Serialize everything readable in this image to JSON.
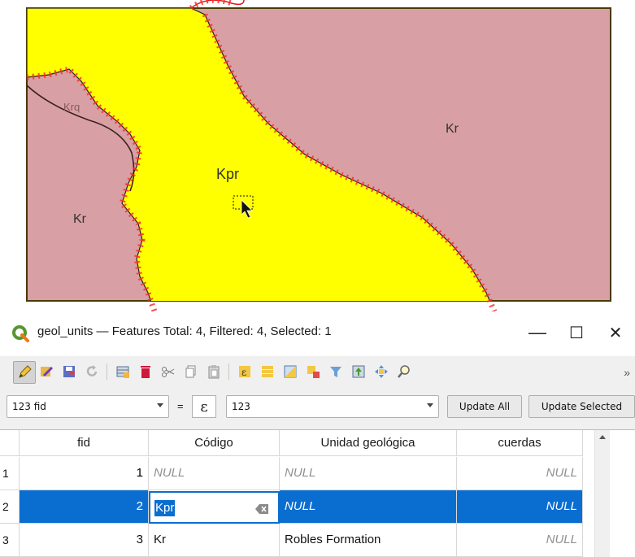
{
  "map": {
    "labels": {
      "krq": "Krq",
      "kr_left": "Kr",
      "kpr": "Kpr",
      "kr_right": "Kr"
    },
    "colors": {
      "yellow_unit": "#ffff00",
      "pink_unit": "#d8a0a4",
      "vertex_markers": "#ff2a2a",
      "boundary": "#2b2b2b"
    }
  },
  "window": {
    "title": "geol_units — Features Total: 4, Filtered: 4, Selected: 1",
    "minimize_symbol": "—",
    "maximize_symbol": "☐",
    "close_symbol": "✕"
  },
  "toolbar": {
    "icons": [
      "toggle-editing-icon",
      "multi-edit-icon",
      "save-edits-icon",
      "reload-icon",
      "add-feature-icon",
      "delete-feature-icon",
      "cut-icon",
      "copy-icon",
      "paste-icon",
      "expression-select-icon",
      "select-all-icon",
      "invert-selection-icon",
      "deselect-icon",
      "filter-icon",
      "move-selection-top-icon",
      "pan-to-selection-icon",
      "zoom-to-selection-icon"
    ],
    "more_label": "»"
  },
  "calc": {
    "field_value": "123 fid",
    "equals": "=",
    "expression_symbol": "ε",
    "value_input": "123",
    "update_all_label": "Update All",
    "update_selected_label": "Update Selected"
  },
  "table": {
    "columns": [
      "fid",
      "Código",
      "Unidad geológica",
      "cuerdas"
    ],
    "rows": [
      {
        "num": "1",
        "fid": "1",
        "codigo": "NULL",
        "unidad": "NULL",
        "cuerdas": "NULL"
      },
      {
        "num": "2",
        "fid": "2",
        "codigo": "Kpr",
        "unidad": "NULL",
        "cuerdas": "NULL"
      },
      {
        "num": "3",
        "fid": "3",
        "codigo": "Kr",
        "unidad": "Robles Formation",
        "cuerdas": "NULL"
      }
    ],
    "selected_row": 2,
    "selection_color": "#0a6ed1",
    "null_color": "#8f8f8f"
  }
}
